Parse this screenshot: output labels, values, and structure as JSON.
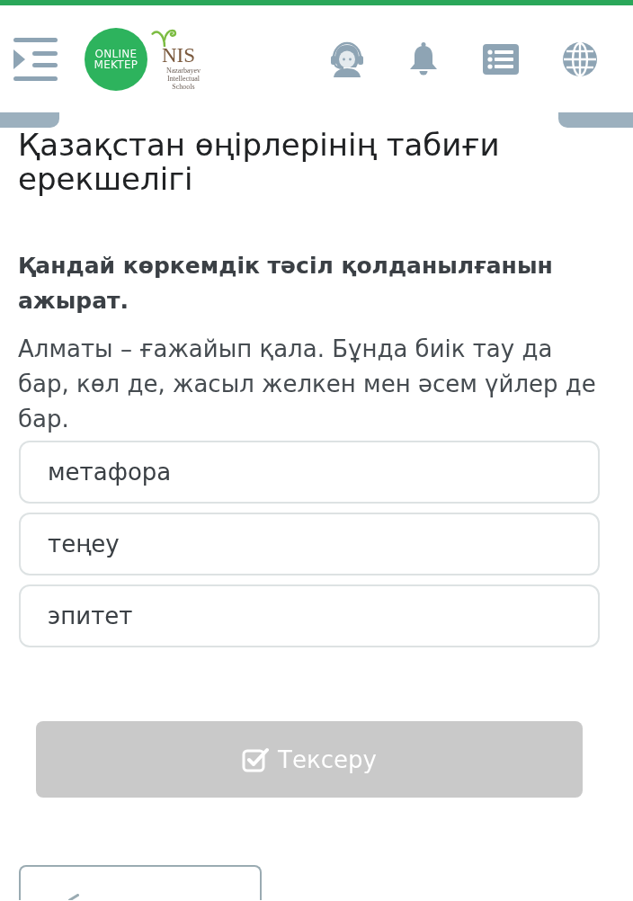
{
  "header": {
    "logo": {
      "lines": [
        "ONLINE",
        "MEKTEP"
      ]
    },
    "partner_logo": {
      "name": "NIS",
      "tagline_lines": [
        "Nazarbayev",
        "Intellectual",
        "Schools"
      ]
    }
  },
  "title": "Қазақстан өңірлерінің табиғи ерекшелігі",
  "question": {
    "prompt": "Қандай көркемдік тәсіл қолданылғанын ажырат.",
    "passage": "Алматы – ғажайып қала. Бұнда биік тау да бар, көл де, жасыл желкен мен әсем үйлер де бар.",
    "options": [
      {
        "label": "метафора",
        "selected": false
      },
      {
        "label": "теңеу",
        "selected": false
      },
      {
        "label": "эпитет",
        "selected": false
      }
    ]
  },
  "check_button": {
    "label": "Тексеру",
    "disabled": true
  }
}
